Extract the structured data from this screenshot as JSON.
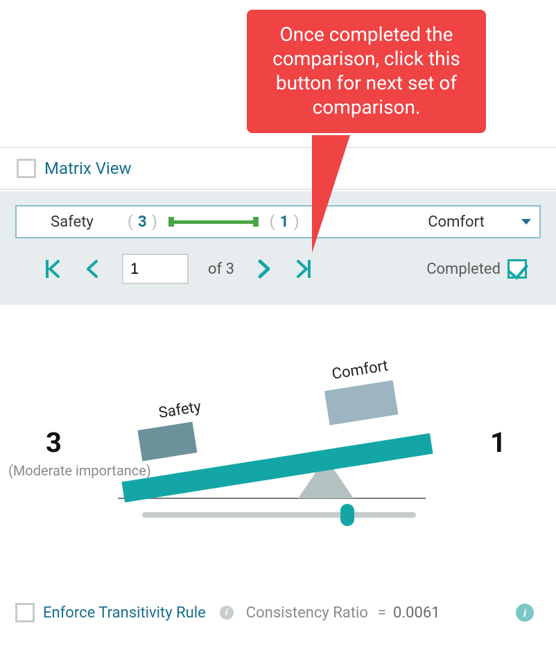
{
  "callout": {
    "text": "Once completed the comparison, click this button for next set of comparison."
  },
  "matrixView": {
    "label": "Matrix View",
    "checked": false
  },
  "comparison": {
    "leftName": "Safety",
    "leftValue": "3",
    "rightValue": "1",
    "rightName": "Comfort"
  },
  "pager": {
    "currentPage": "1",
    "totalPages": "3",
    "ofLabel": "of",
    "completedLabel": "Completed",
    "completedChecked": true
  },
  "seesaw": {
    "leftNumber": "3",
    "rightNumber": "1",
    "leftLabel": "Safety",
    "rightLabel": "Comfort",
    "importanceLabel": "(Moderate importance)"
  },
  "footer": {
    "transitivityLabel": "Enforce Transitivity Rule",
    "transitivityChecked": false,
    "consistencyLabel": "Consistency Ratio",
    "equals": "=",
    "consistencyValue": "0.0061"
  },
  "colors": {
    "accent": "#14a6a6",
    "green": "#4aa546",
    "link": "#1a6e8e",
    "callout": "#ef4344"
  }
}
